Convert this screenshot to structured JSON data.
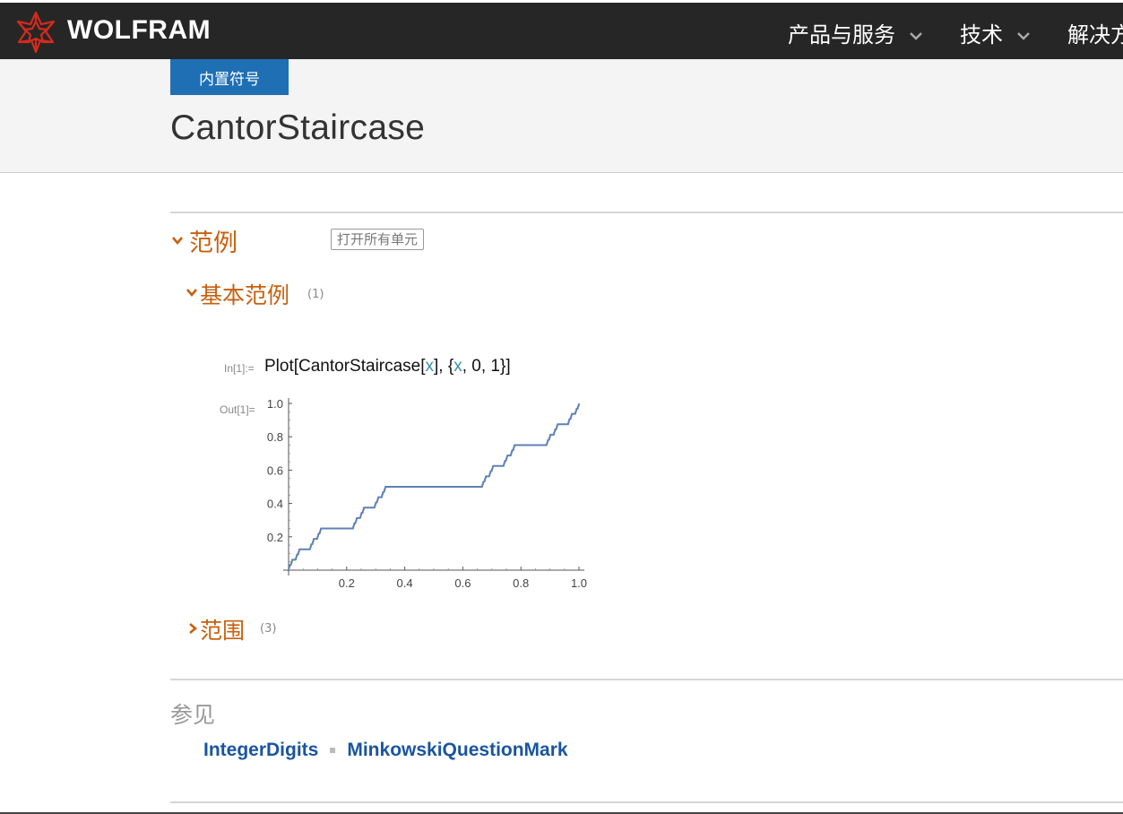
{
  "header": {
    "brand": "WOLFRAM",
    "nav": [
      {
        "label": "产品与服务"
      },
      {
        "label": "技术"
      },
      {
        "label": "解决方"
      }
    ]
  },
  "page": {
    "badge": "内置符号",
    "title": "CantorStaircase"
  },
  "examples": {
    "heading": "范例",
    "open_all_button": "打开所有单元",
    "basic": {
      "heading": "基本范例",
      "count": "(1)",
      "in_label": "In[1]:=",
      "input_parts": [
        "Plot[CantorStaircase[",
        "x",
        "], {",
        "x",
        ", 0, 1}]"
      ],
      "out_label": "Out[1]="
    },
    "scope": {
      "heading": "范围",
      "count": "(3)"
    }
  },
  "see_also": {
    "heading": "参见",
    "links": [
      "IntegerDigits",
      "MinkowskiQuestionMark"
    ]
  },
  "colors": {
    "nav_bg": "#262626",
    "badge_bg": "#1f6fb5",
    "section_orange": "#c8600e",
    "link_blue": "#1a55a0",
    "plot_line": "#5e81b5",
    "logo_red": "#d42a1e"
  },
  "chart_data": {
    "type": "line",
    "function": "CantorStaircase",
    "x_range": [
      0,
      1
    ],
    "xlim": [
      0,
      1
    ],
    "ylim": [
      0,
      1
    ],
    "x_ticks": [
      "0.2",
      "0.4",
      "0.6",
      "0.8",
      "1.0"
    ],
    "y_ticks": [
      "0.2",
      "0.4",
      "0.6",
      "0.8",
      "1.0"
    ],
    "grid": false
  }
}
